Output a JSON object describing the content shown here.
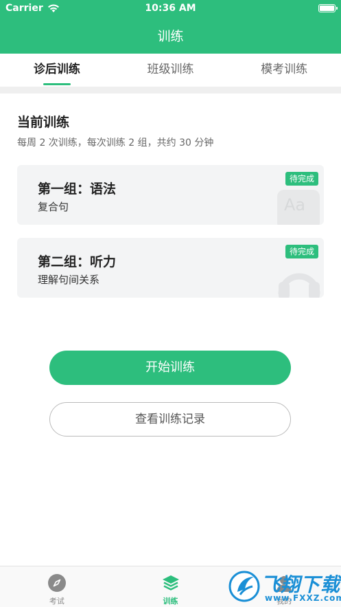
{
  "status_bar": {
    "carrier": "Carrier",
    "time": "10:36 AM"
  },
  "nav": {
    "title": "训练"
  },
  "tabs": [
    {
      "label": "诊后训练",
      "active": true
    },
    {
      "label": "班级训练",
      "active": false
    },
    {
      "label": "模考训练",
      "active": false
    }
  ],
  "current": {
    "title": "当前训练",
    "subtitle": "每周 2 次训练，每次训练 2 组，共约 30 分钟"
  },
  "cards": [
    {
      "title": "第一组：语法",
      "subtitle": "复合句",
      "badge": "待完成",
      "icon": "text-aa-icon"
    },
    {
      "title": "第二组：听力",
      "subtitle": "理解句间关系",
      "badge": "待完成",
      "icon": "headphones-icon"
    }
  ],
  "buttons": {
    "start": "开始训练",
    "history": "查看训练记录"
  },
  "tabbar": [
    {
      "label": "考试",
      "icon": "compass-icon",
      "active": false
    },
    {
      "label": "训练",
      "icon": "layers-icon",
      "active": true
    },
    {
      "label": "我的",
      "icon": "profile-icon",
      "active": false
    }
  ],
  "watermark": {
    "text": "飞翔下载",
    "url": "www.FXXZ.com"
  },
  "colors": {
    "accent": "#2dbe7d",
    "watermark": "#1a8fd6"
  }
}
